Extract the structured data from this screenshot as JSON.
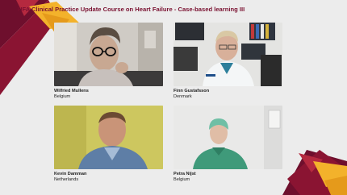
{
  "header": {
    "title": "HFA Clinical Practice Update Course on Heart Failure - Case-based learning III"
  },
  "participants": [
    {
      "name": "Wilfried Mullens",
      "country": "Belgium"
    },
    {
      "name": "Finn Gustafsson",
      "country": "Denmark"
    },
    {
      "name": "Kevin Damman",
      "country": "Netherlands"
    },
    {
      "name": "Petra Nijst",
      "country": "Belgium"
    }
  ],
  "colors": {
    "brand_dark": "#6e0f2d",
    "brand_red": "#a01c3a",
    "brand_gold": "#f3b22b",
    "background": "#ececec"
  }
}
